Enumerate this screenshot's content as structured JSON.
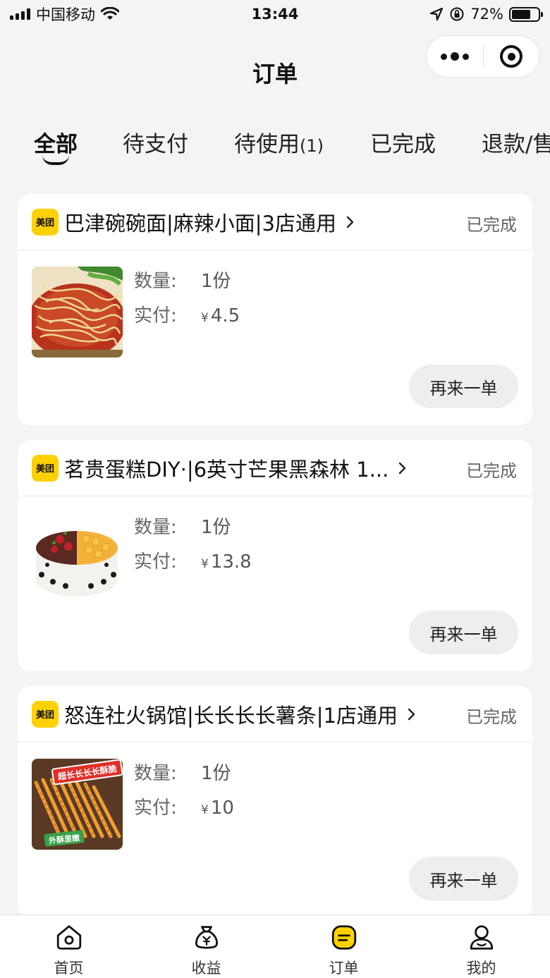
{
  "status_bar": {
    "carrier": "中国移动",
    "time": "13:44",
    "battery": "72%",
    "battery_level": 0.72
  },
  "header": {
    "title": "订单"
  },
  "tabs": [
    {
      "label": "全部",
      "active": true
    },
    {
      "label": "待支付"
    },
    {
      "label": "待使用",
      "count": "(1)"
    },
    {
      "label": "已完成"
    },
    {
      "label": "退款/售"
    }
  ],
  "orders": [
    {
      "brand": "美团",
      "shop": "巴津碗碗面|麻辣小面|3店通用",
      "status": "已完成",
      "qty_label": "数量:",
      "qty_value": "1份",
      "paid_label": "实付:",
      "currency": "¥",
      "paid_value": "4.5",
      "button": "再来一单",
      "image": "noodles"
    },
    {
      "brand": "美团",
      "shop": "茗贵蛋糕DIY·|6英寸芒果黑森林 1...",
      "status": "已完成",
      "qty_label": "数量:",
      "qty_value": "1份",
      "paid_label": "实付:",
      "currency": "¥",
      "paid_value": "13.8",
      "button": "再来一单",
      "image": "cake"
    },
    {
      "brand": "美团",
      "shop": "怒连社火锅馆|长长长长薯条|1店通用",
      "status": "已完成",
      "qty_label": "数量:",
      "qty_value": "1份",
      "paid_label": "实付:",
      "currency": "¥",
      "paid_value": "10",
      "button": "再来一单",
      "image": "fries",
      "image_texts": [
        "超长长长长酥脆",
        "外酥里嫩"
      ]
    }
  ],
  "bottom_nav": [
    {
      "label": "首页",
      "icon": "home-icon"
    },
    {
      "label": "收益",
      "icon": "money-bag-icon"
    },
    {
      "label": "订单",
      "icon": "orders-icon",
      "active": true
    },
    {
      "label": "我的",
      "icon": "profile-icon"
    }
  ],
  "colors": {
    "accent": "#ffd100",
    "background": "#f4f4f4"
  }
}
